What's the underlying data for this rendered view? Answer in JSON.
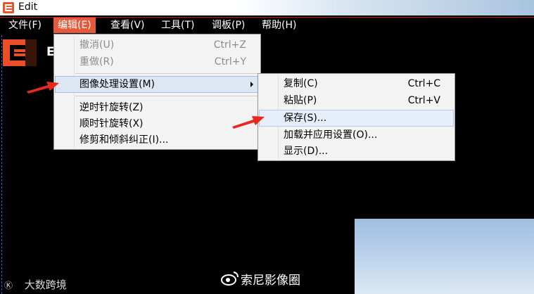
{
  "window": {
    "title": "Edit",
    "accent_color": "#e35a3c"
  },
  "menubar": {
    "items": [
      {
        "label": "文件(F)"
      },
      {
        "label": "编辑(E)",
        "active": true
      },
      {
        "label": "查看(V)"
      },
      {
        "label": "工具(T)"
      },
      {
        "label": "调板(P)"
      },
      {
        "label": "帮助(H)"
      }
    ]
  },
  "app": {
    "logo_text": "E"
  },
  "edit_menu": {
    "items": [
      {
        "label": "撤消(U)",
        "shortcut": "Ctrl+Z",
        "disabled": true
      },
      {
        "label": "重做(R)",
        "shortcut": "Ctrl+Y",
        "disabled": true
      },
      {
        "label": "图像处理设置(M)",
        "submenu": true,
        "highlighted": true
      },
      {
        "label": "逆时针旋转(Z)"
      },
      {
        "label": "顺时针旋转(X)"
      },
      {
        "label": "修剪和倾斜纠正(I)..."
      }
    ]
  },
  "submenu": {
    "items": [
      {
        "label": "复制(C)",
        "shortcut": "Ctrl+C"
      },
      {
        "label": "粘贴(P)",
        "shortcut": "Ctrl+V"
      },
      {
        "label": "保存(S)...",
        "highlighted": true
      },
      {
        "label": "加载并应用设置(O)..."
      },
      {
        "label": "显示(D)..."
      }
    ]
  },
  "annotations": {
    "arrow_color": "#e8281e"
  },
  "watermarks": {
    "left": "大数跨境",
    "center": "索尼影像圈"
  }
}
